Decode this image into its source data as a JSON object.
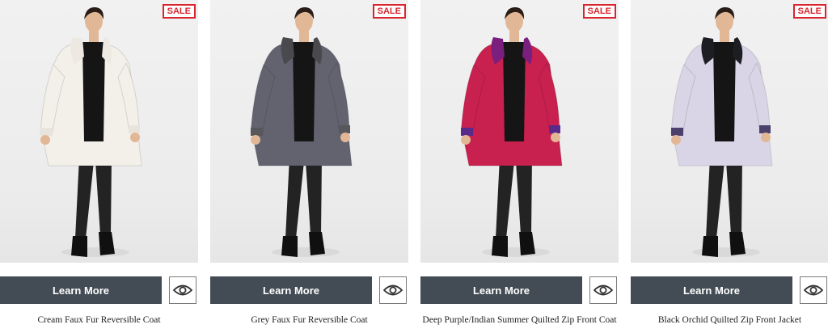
{
  "products": [
    {
      "name": "Cream Faux Fur Reversible Coat",
      "badge": "SALE",
      "button_label": "Learn More",
      "coat_color": "#f3f0ea",
      "collar_color": "#ede9e2",
      "trim_color": "#e8e4dc",
      "top_color": "#151515"
    },
    {
      "name": "Grey Faux Fur Reversible Coat",
      "badge": "SALE",
      "button_label": "Learn More",
      "coat_color": "#63626f",
      "collar_color": "#4a4a4e",
      "trim_color": "#57575c",
      "top_color": "#151515"
    },
    {
      "name": "Deep Purple/Indian Summer Quilted Zip Front Coat",
      "badge": "SALE",
      "button_label": "Learn More",
      "coat_color": "#c8204f",
      "collar_color": "#7a1f7e",
      "trim_color": "#5a2a8a",
      "top_color": "#151515"
    },
    {
      "name": "Black Orchid Quilted Zip Front Jacket",
      "badge": "SALE",
      "button_label": "Learn More",
      "coat_color": "#d9d4e6",
      "collar_color": "#1d1d24",
      "trim_color": "#4b3f6b",
      "top_color": "#151515"
    }
  ],
  "colors": {
    "button_bg": "#434c54",
    "sale_red": "#d8262e",
    "background": "#ffffff"
  },
  "icons": {
    "quick_view": "eye-icon"
  }
}
